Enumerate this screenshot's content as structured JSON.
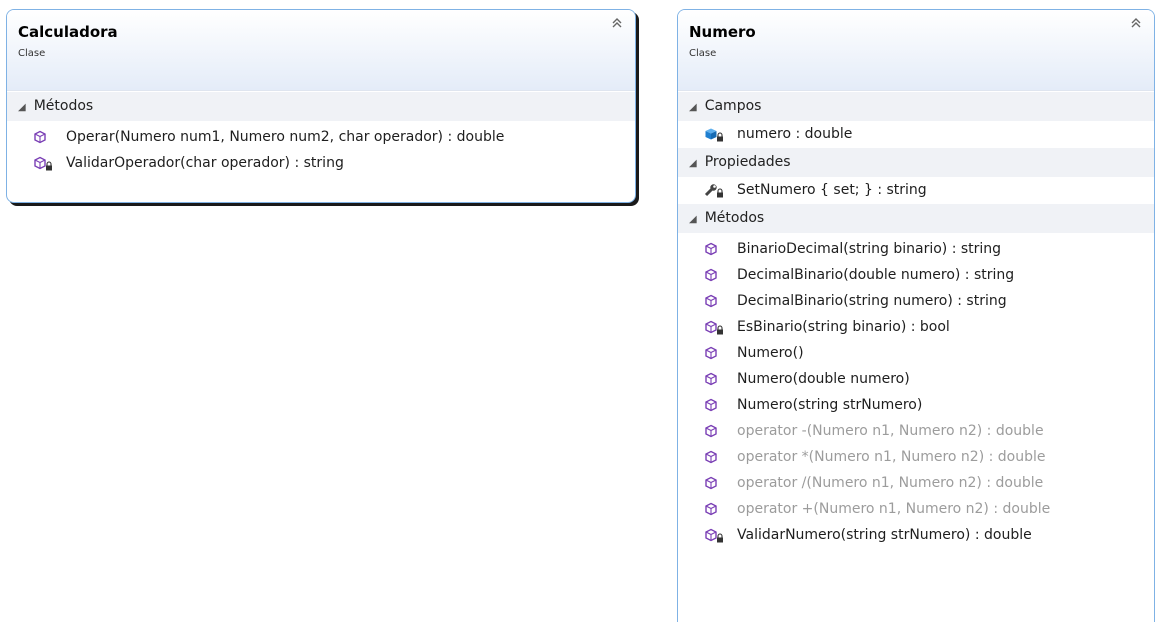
{
  "classes": [
    {
      "name": "Calculadora",
      "stereotype": "Clase",
      "collapse_icon": "double-chevron-up-icon",
      "compartments": [
        {
          "title": "Métodos",
          "members": [
            {
              "text": "Operar(Numero num1, Numero num2, char operador) : double",
              "icon": "method-icon",
              "dim": false
            },
            {
              "text": "ValidarOperador(char operador) : string",
              "icon": "private-method-icon",
              "dim": false
            }
          ]
        }
      ]
    },
    {
      "name": "Numero",
      "stereotype": "Clase",
      "collapse_icon": "double-chevron-up-icon",
      "compartments": [
        {
          "title": "Campos",
          "members": [
            {
              "text": "numero : double",
              "icon": "private-field-icon",
              "dim": false
            }
          ]
        },
        {
          "title": "Propiedades",
          "members": [
            {
              "text": "SetNumero { set; } : string",
              "icon": "private-property-icon",
              "dim": false
            }
          ]
        },
        {
          "title": "Métodos",
          "members": [
            {
              "text": "BinarioDecimal(string binario) : string",
              "icon": "method-icon",
              "dim": false
            },
            {
              "text": "DecimalBinario(double numero) : string",
              "icon": "method-icon",
              "dim": false
            },
            {
              "text": "DecimalBinario(string numero) : string",
              "icon": "method-icon",
              "dim": false
            },
            {
              "text": "EsBinario(string binario) : bool",
              "icon": "private-method-icon",
              "dim": false
            },
            {
              "text": "Numero()",
              "icon": "method-icon",
              "dim": false
            },
            {
              "text": "Numero(double numero)",
              "icon": "method-icon",
              "dim": false
            },
            {
              "text": "Numero(string strNumero)",
              "icon": "method-icon",
              "dim": false
            },
            {
              "text": "operator -(Numero n1, Numero n2) : double",
              "icon": "method-icon",
              "dim": true
            },
            {
              "text": "operator *(Numero n1, Numero n2) : double",
              "icon": "method-icon",
              "dim": true
            },
            {
              "text": "operator /(Numero n1, Numero n2) : double",
              "icon": "method-icon",
              "dim": true
            },
            {
              "text": "operator +(Numero n1, Numero n2) : double",
              "icon": "method-icon",
              "dim": true
            },
            {
              "text": "ValidarNumero(string strNumero) : double",
              "icon": "private-method-icon",
              "dim": false
            }
          ]
        }
      ]
    }
  ],
  "colors": {
    "border": "#7fb2e5",
    "method_purple": "#7a3fb5",
    "field_blue": "#1f7fd0",
    "dim_text": "#9c9c9c"
  }
}
